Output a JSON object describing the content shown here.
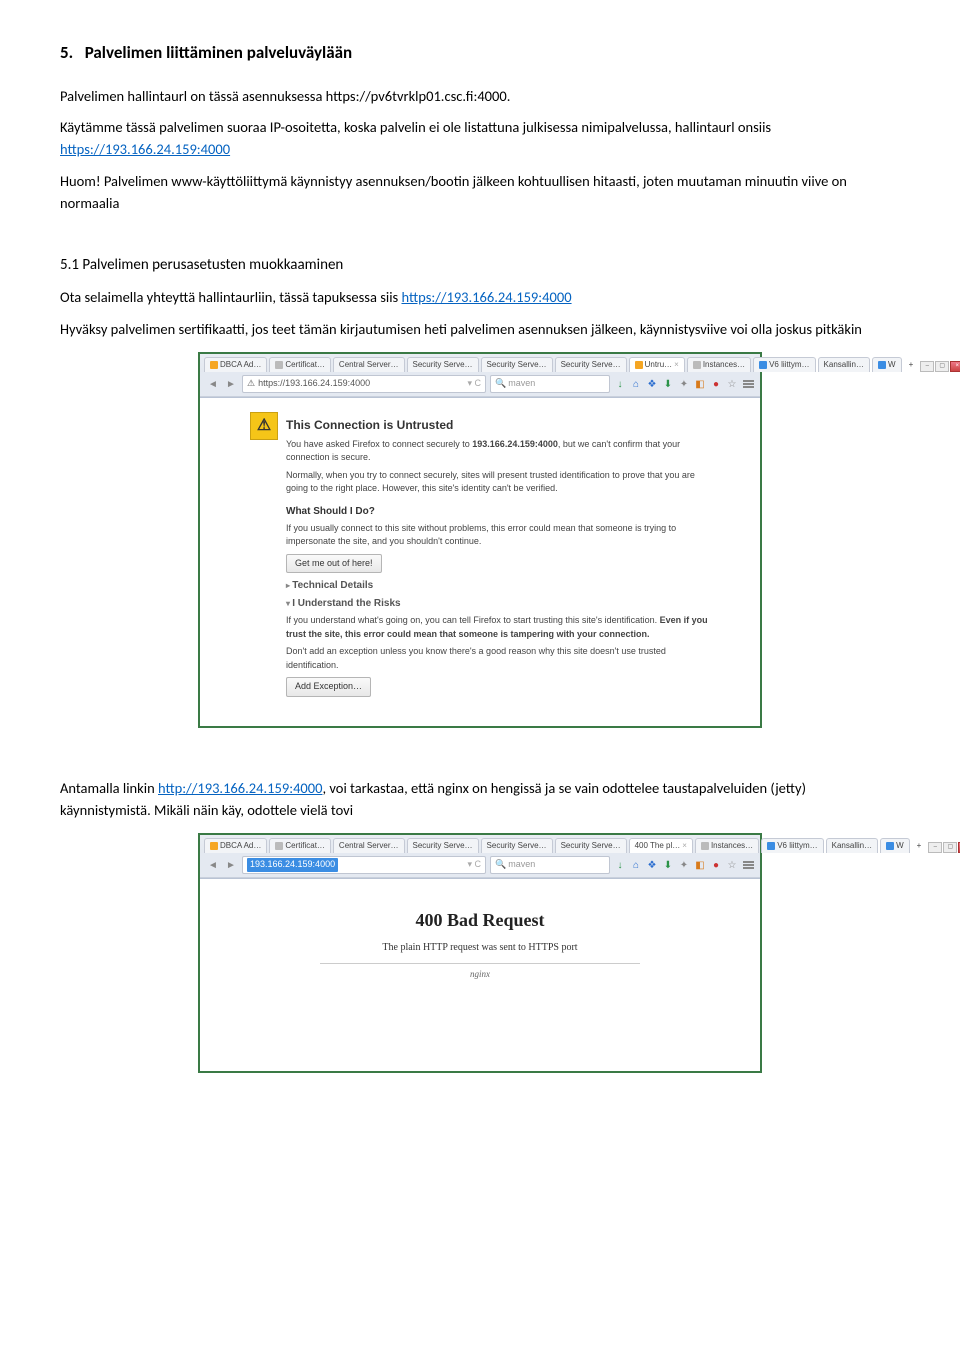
{
  "section": {
    "number": "5.",
    "title": "Palvelimen liittäminen palveluväylään"
  },
  "para1a": "Palvelimen hallintaurl on tässä asennuksessa https://pv6tvrklp01.csc.fi:4000.",
  "para2a": "Käytämme tässä palvelimen suoraa IP-osoitetta, koska palvelin ei ole listattuna julkisessa nimipalvelussa, hallintaurl onsiis ",
  "para2_link": "https://193.166.24.159:4000",
  "para3": "Huom! Palvelimen www-käyttöliittymä käynnistyy asennuksen/bootin jälkeen kohtuullisen hitaasti, joten muutaman minuutin viive on normaalia",
  "subsection": {
    "number": "5.1",
    "title": "Palvelimen perusasetusten muokkaaminen"
  },
  "para4a": "Ota selaimella yhteyttä hallintaurliin, tässä tapuksessa siis ",
  "para4_link": "https://193.166.24.159:4000",
  "para5": "Hyväksy palvelimen sertifikaatti, jos teet tämän kirjautumisen heti palvelimen asennuksen jälkeen, käynnistysviive voi olla joskus pitkäkin",
  "para6a": "Antamalla linkin ",
  "para6_link": "http://193.166.24.159:4000",
  "para6b": ", voi tarkastaa, että nginx on hengissä ja se vain odottelee taustapalveluiden (jetty) käynnistymistä. Mikäli näin käy, odottele vielä tovi",
  "browser": {
    "tabs": [
      "DBCA Ad…",
      "Certificat…",
      "Central Server…",
      "Security Serve…",
      "Security Serve…",
      "Security Serve…",
      "Untru…",
      "Instances…",
      "V6 liittym…",
      "Kansallin…",
      "W"
    ],
    "activeTabIndex": 6,
    "url1": "https://193.166.24.159:4000",
    "url2": "193.166.24.159:4000",
    "search": "maven",
    "plus": "+"
  },
  "untrusted": {
    "title": "This Connection is Untrusted",
    "p1a": "You have asked Firefox to connect securely to ",
    "p1_host": "193.166.24.159:4000",
    "p1b": ", but we can't confirm that your connection is secure.",
    "p2": "Normally, when you try to connect securely, sites will present trusted identification to prove that you are going to the right place. However, this site's identity can't be verified.",
    "sub1": "What Should I Do?",
    "p3": "If you usually connect to this site without problems, this error could mean that someone is trying to impersonate the site, and you shouldn't continue.",
    "btn1": "Get me out of here!",
    "d1": "Technical Details",
    "d2": "I Understand the Risks",
    "p4a": "If you understand what's going on, you can tell Firefox to start trusting this site's identification. ",
    "p4_bold": "Even if you trust the site, this error could mean that someone is tampering with your connection.",
    "p5": "Don't add an exception unless you know there's a good reason why this site doesn't use trusted identification.",
    "btn2": "Add Exception…"
  },
  "badreq": {
    "title": "400 Bad Request",
    "msg": "The plain HTTP request was sent to HTTPS port",
    "sig": "nginx"
  },
  "tabs2_active": "400 The pl…"
}
